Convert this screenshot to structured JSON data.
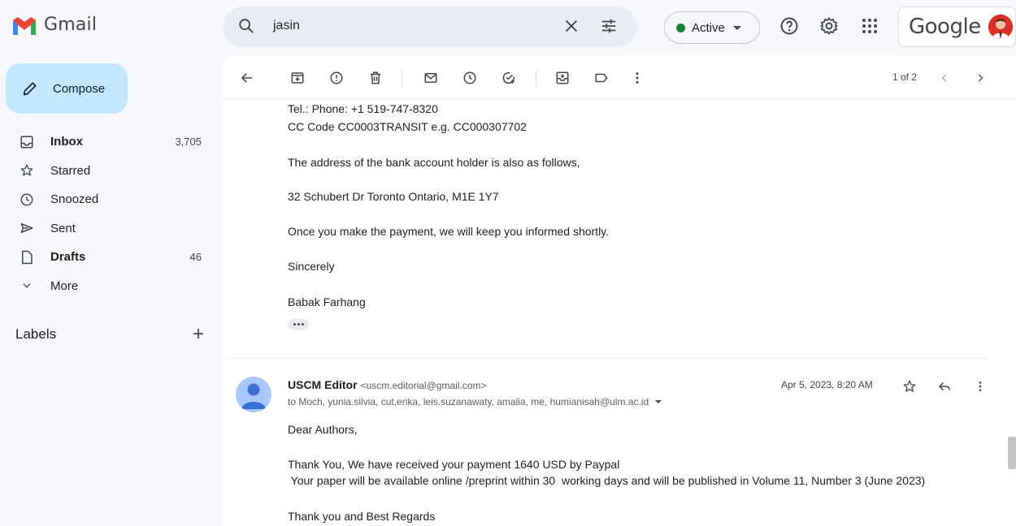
{
  "app": {
    "name": "Gmail"
  },
  "search": {
    "query": "jasin"
  },
  "status": {
    "label": "Active"
  },
  "account": {
    "brand": "Google"
  },
  "sidebar": {
    "compose_label": "Compose",
    "items": [
      {
        "label": "Inbox",
        "count": "3,705",
        "icon": "inbox-icon"
      },
      {
        "label": "Starred",
        "count": "",
        "icon": "star-icon"
      },
      {
        "label": "Snoozed",
        "count": "",
        "icon": "clock-icon"
      },
      {
        "label": "Sent",
        "count": "",
        "icon": "send-icon"
      },
      {
        "label": "Drafts",
        "count": "46",
        "icon": "draft-icon"
      },
      {
        "label": "More",
        "count": "",
        "icon": "chevron-down-icon"
      }
    ],
    "labels_heading": "Labels"
  },
  "toolbar": {
    "pager": "1 of 2"
  },
  "message1": {
    "lines": [
      "Tel.: Phone: +1 519-747-8320",
      "CC Code  CC0003TRANSIT  e.g. CC000307702",
      "The address of the bank account holder is also as follows,",
      "32 Schubert Dr Toronto Ontario, M1E 1Y7",
      "Once you make the payment, we will keep you informed shortly.",
      "Sincerely",
      "Babak Farhang"
    ]
  },
  "message2": {
    "sender_name": "USCM Editor",
    "sender_email": "<uscm.editorial@gmail.com>",
    "recipients": "to Moch, yunia.silvia, cut.erika, leis.suzanawaty, amalia, me, humianisah@ulm.ac.id",
    "date": "Apr 5, 2023, 8:20 AM",
    "lines": [
      "Dear Authors,",
      "Thank You, We have received your payment 1640  USD by Paypal",
      " Your paper will be available online /preprint within 30  working days and will be published in Volume 11, Number 3 (June 2023)",
      "Thank you and  Best Regards"
    ]
  },
  "colors": {
    "accent": "#c2e7ff",
    "active": "#188038",
    "search_bg": "#e9eef6"
  }
}
